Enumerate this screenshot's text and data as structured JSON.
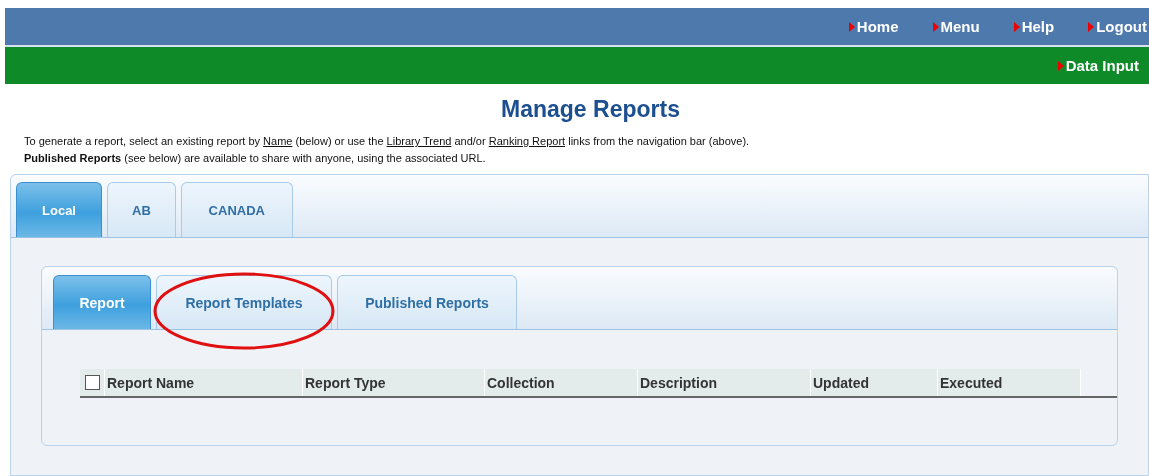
{
  "top_nav": [
    "Home",
    "Menu",
    "Help",
    "Logout"
  ],
  "sub_nav": [
    "Data Input"
  ],
  "title": "Manage Reports",
  "intro": [
    {
      "kind": "text",
      "text": "To generate a report, select an existing report by "
    },
    {
      "kind": "link",
      "text": "Name"
    },
    {
      "kind": "text",
      "text": " (below) or use the "
    },
    {
      "kind": "link",
      "text": "Library Trend"
    },
    {
      "kind": "text",
      "text": " and/or "
    },
    {
      "kind": "link",
      "text": "Ranking Report"
    },
    {
      "kind": "text",
      "text": " links from the navigation bar (above)."
    }
  ],
  "note": "**Published Reports** (see below) are available to share with anyone, using the associated URL.",
  "outer_tabs": [
    {
      "label": "Local",
      "selected": true
    },
    {
      "label": "AB",
      "selected": false
    },
    {
      "label": "CANADA",
      "selected": false
    }
  ],
  "inner_tabs": [
    {
      "label": "Report",
      "selected": true,
      "highlighted": false
    },
    {
      "label": "Report Templates",
      "selected": false,
      "highlighted": true
    },
    {
      "label": "Published Reports",
      "selected": false,
      "highlighted": false
    }
  ],
  "table": {
    "select_all_checked": false,
    "columns": [
      "Report Name",
      "Report Type",
      "Collection",
      "Description",
      "Updated",
      "Executed"
    ]
  }
}
